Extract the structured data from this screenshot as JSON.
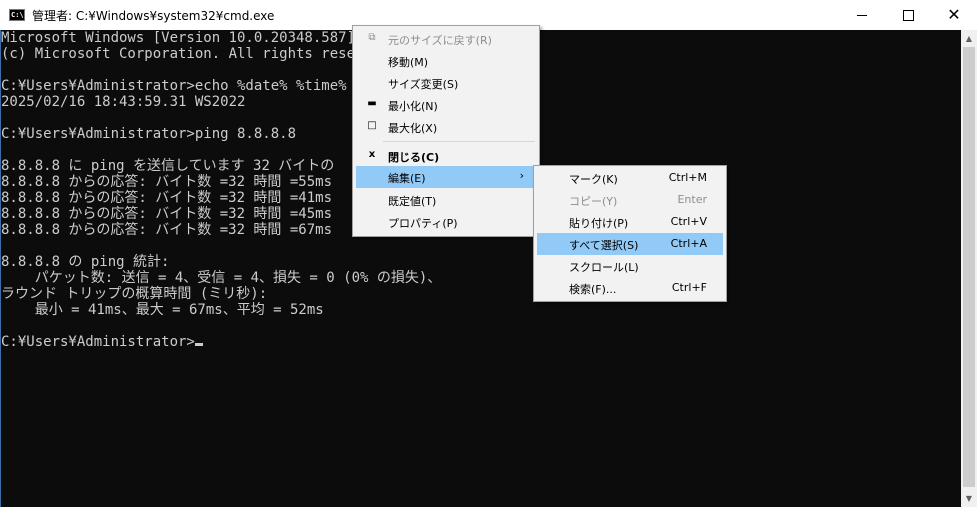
{
  "window": {
    "title": "管理者: C:¥Windows¥system32¥cmd.exe",
    "icon": "C:\\"
  },
  "console": {
    "lines": [
      "Microsoft Windows [Version 10.0.20348.587]",
      "(c) Microsoft Corporation. All rights reserv",
      "",
      "C:¥Users¥Administrator>echo %date% %time% %c",
      "2025/02/16 18:43:59.31 WS2022",
      "",
      "C:¥Users¥Administrator>ping 8.8.8.8",
      "",
      "8.8.8.8 に ping を送信しています 32 バイトの",
      "8.8.8.8 からの応答: バイト数 =32 時間 =55ms",
      "8.8.8.8 からの応答: バイト数 =32 時間 =41ms",
      "8.8.8.8 からの応答: バイト数 =32 時間 =45ms",
      "8.8.8.8 からの応答: バイト数 =32 時間 =67ms",
      "",
      "8.8.8.8 の ping 統計:",
      "    パケット数: 送信 = 4、受信 = 4、損失 = 0 (0% の損失)、",
      "ラウンド トリップの概算時間 (ミリ秒):",
      "    最小 = 41ms、最大 = 67ms、平均 = 52ms",
      "",
      "C:¥Users¥Administrator>"
    ]
  },
  "system_menu": {
    "items": [
      {
        "label": "元のサイズに戻す(R)",
        "glyph": "⧉",
        "disabled": true
      },
      {
        "label": "移動(M)",
        "glyph": ""
      },
      {
        "label": "サイズ変更(S)",
        "glyph": ""
      },
      {
        "label": "最小化(N)",
        "glyph": "▬"
      },
      {
        "label": "最大化(X)",
        "glyph": "□"
      },
      {
        "label": "閉じる(C)",
        "glyph": "x",
        "bold": true
      },
      {
        "label": "編集(E)",
        "glyph": "",
        "submenu": "›",
        "highlight": true
      },
      {
        "label": "既定値(T)",
        "glyph": ""
      },
      {
        "label": "プロパティ(P)",
        "glyph": ""
      }
    ]
  },
  "edit_submenu": {
    "items": [
      {
        "label": "マーク(K)",
        "shortcut": "Ctrl+M"
      },
      {
        "label": "コピー(Y)",
        "shortcut": "Enter",
        "disabled": true
      },
      {
        "label": "貼り付け(P)",
        "shortcut": "Ctrl+V"
      },
      {
        "label": "すべて選択(S)",
        "shortcut": "Ctrl+A",
        "highlight": true
      },
      {
        "label": "スクロール(L)",
        "shortcut": ""
      },
      {
        "label": "検索(F)...",
        "shortcut": "Ctrl+F"
      }
    ]
  }
}
